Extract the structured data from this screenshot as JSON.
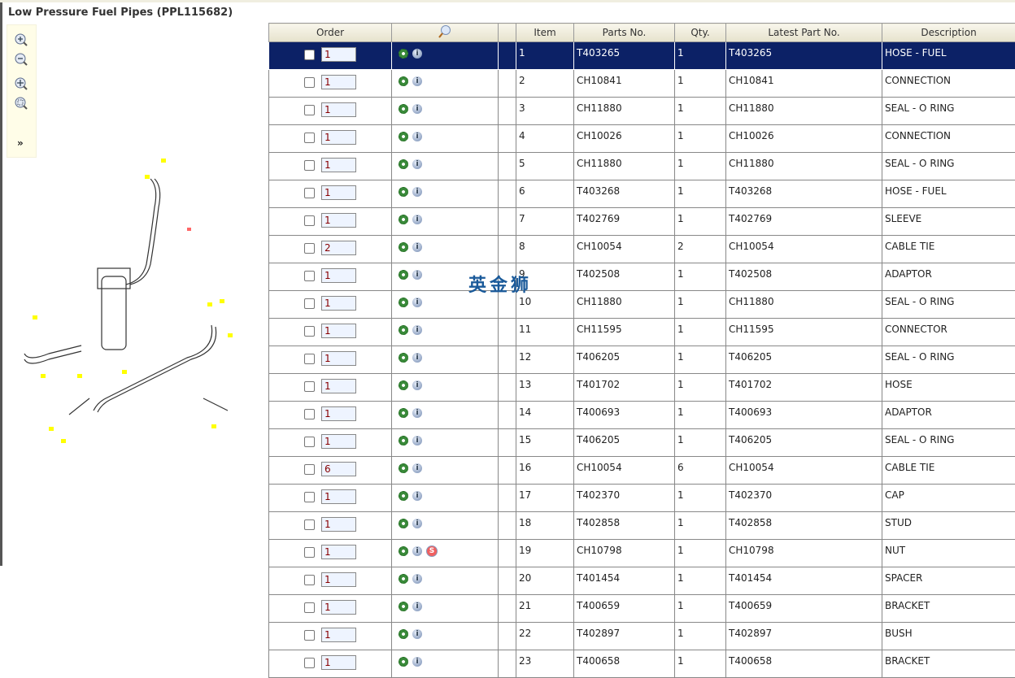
{
  "title": "Low Pressure Fuel Pipes (PPL115682)",
  "toolbar": {
    "expand_label": "»"
  },
  "watermark": "英金狮",
  "columns": {
    "order": "Order",
    "item": "Item",
    "parts_no": "Parts No.",
    "qty": "Qty.",
    "latest": "Latest Part No.",
    "description": "Description"
  },
  "rows": [
    {
      "order": "1",
      "item": "1",
      "part": "T403265",
      "qty": "1",
      "latest": "T403265",
      "desc": "HOSE - FUEL"
    },
    {
      "order": "1",
      "item": "2",
      "part": "CH10841",
      "qty": "1",
      "latest": "CH10841",
      "desc": "CONNECTION"
    },
    {
      "order": "1",
      "item": "3",
      "part": "CH11880",
      "qty": "1",
      "latest": "CH11880",
      "desc": "SEAL - O RING"
    },
    {
      "order": "1",
      "item": "4",
      "part": "CH10026",
      "qty": "1",
      "latest": "CH10026",
      "desc": "CONNECTION"
    },
    {
      "order": "1",
      "item": "5",
      "part": "CH11880",
      "qty": "1",
      "latest": "CH11880",
      "desc": "SEAL - O RING"
    },
    {
      "order": "1",
      "item": "6",
      "part": "T403268",
      "qty": "1",
      "latest": "T403268",
      "desc": "HOSE - FUEL"
    },
    {
      "order": "1",
      "item": "7",
      "part": "T402769",
      "qty": "1",
      "latest": "T402769",
      "desc": "SLEEVE"
    },
    {
      "order": "2",
      "item": "8",
      "part": "CH10054",
      "qty": "2",
      "latest": "CH10054",
      "desc": "CABLE TIE"
    },
    {
      "order": "1",
      "item": "9",
      "part": "T402508",
      "qty": "1",
      "latest": "T402508",
      "desc": "ADAPTOR"
    },
    {
      "order": "1",
      "item": "10",
      "part": "CH11880",
      "qty": "1",
      "latest": "CH11880",
      "desc": "SEAL - O RING"
    },
    {
      "order": "1",
      "item": "11",
      "part": "CH11595",
      "qty": "1",
      "latest": "CH11595",
      "desc": "CONNECTOR"
    },
    {
      "order": "1",
      "item": "12",
      "part": "T406205",
      "qty": "1",
      "latest": "T406205",
      "desc": "SEAL - O RING"
    },
    {
      "order": "1",
      "item": "13",
      "part": "T401702",
      "qty": "1",
      "latest": "T401702",
      "desc": "HOSE"
    },
    {
      "order": "1",
      "item": "14",
      "part": "T400693",
      "qty": "1",
      "latest": "T400693",
      "desc": "ADAPTOR"
    },
    {
      "order": "1",
      "item": "15",
      "part": "T406205",
      "qty": "1",
      "latest": "T406205",
      "desc": "SEAL - O RING"
    },
    {
      "order": "6",
      "item": "16",
      "part": "CH10054",
      "qty": "6",
      "latest": "CH10054",
      "desc": "CABLE TIE"
    },
    {
      "order": "1",
      "item": "17",
      "part": "T402370",
      "qty": "1",
      "latest": "T402370",
      "desc": "CAP"
    },
    {
      "order": "1",
      "item": "18",
      "part": "T402858",
      "qty": "1",
      "latest": "T402858",
      "desc": "STUD"
    },
    {
      "order": "1",
      "item": "19",
      "part": "CH10798",
      "qty": "1",
      "latest": "CH10798",
      "desc": "NUT",
      "sub": "S"
    },
    {
      "order": "1",
      "item": "20",
      "part": "T401454",
      "qty": "1",
      "latest": "T401454",
      "desc": "SPACER"
    },
    {
      "order": "1",
      "item": "21",
      "part": "T400659",
      "qty": "1",
      "latest": "T400659",
      "desc": "BRACKET"
    },
    {
      "order": "1",
      "item": "22",
      "part": "T402897",
      "qty": "1",
      "latest": "T402897",
      "desc": "BUSH"
    },
    {
      "order": "1",
      "item": "23",
      "part": "T400658",
      "qty": "1",
      "latest": "T400658",
      "desc": "BRACKET"
    }
  ]
}
